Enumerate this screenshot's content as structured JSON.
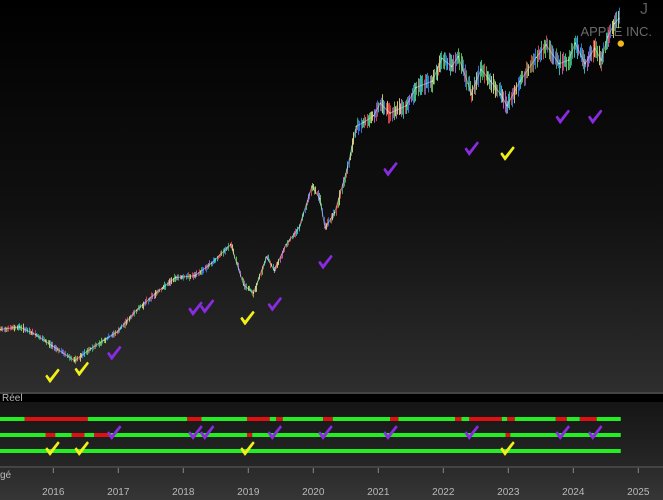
{
  "header": {
    "company_name": "APPLE INC.",
    "corner_symbol": "J"
  },
  "panels": {
    "mode_label": "Réel",
    "indicator_label": "gé"
  },
  "colors": {
    "background": "#000000",
    "axis_text": "#b9b9b9",
    "band_green": "#22ee22",
    "band_red": "#dd1111",
    "check_yellow": "#f2ef1a",
    "check_purple": "#8a2be2",
    "last_price_marker": "#f2b619"
  },
  "icons": {
    "signal_strong": "yellow-check-icon",
    "signal_normal": "purple-check-icon"
  },
  "chart_data": {
    "type": "line",
    "title": "APPLE INC.",
    "xlabel": "",
    "ylabel": "",
    "x_ticks": [
      "2016",
      "2017",
      "2018",
      "2019",
      "2020",
      "2021",
      "2022",
      "2023",
      "2024",
      "2025"
    ],
    "x_range": [
      2015.2,
      2025.4
    ],
    "y_scale": "log",
    "grid": false,
    "series": [
      {
        "x": [
          2015.2,
          2015.5,
          2015.75,
          2016.0,
          2016.35,
          2016.6,
          2016.8,
          2017.0,
          2017.3,
          2017.6,
          2017.9,
          2018.2,
          2018.45,
          2018.75,
          2018.95,
          2019.1,
          2019.3,
          2019.42,
          2019.6,
          2019.8,
          2020.0,
          2020.12,
          2020.2,
          2020.35,
          2020.55,
          2020.68,
          2020.8,
          2020.95,
          2021.05,
          2021.2,
          2021.45,
          2021.6,
          2021.85,
          2022.0,
          2022.15,
          2022.25,
          2022.4,
          2022.45,
          2022.6,
          2022.75,
          2022.9,
          2023.0,
          2023.2,
          2023.45,
          2023.6,
          2023.8,
          2023.95,
          2024.05,
          2024.2,
          2024.35,
          2024.45,
          2024.55,
          2024.65,
          2024.72
        ],
        "values": [
          30,
          30.5,
          29,
          27,
          24.5,
          26.5,
          28,
          29.5,
          34,
          38,
          42,
          42.5,
          46,
          52,
          40,
          38,
          48,
          44,
          52,
          58,
          76,
          70,
          58,
          64,
          86,
          112,
          115,
          120,
          130,
          122,
          128,
          144,
          150,
          174,
          165,
          176,
          148,
          138,
          162,
          150,
          138,
          128,
          150,
          175,
          190,
          168,
          172,
          192,
          168,
          186,
          172,
          200,
          218,
          225
        ]
      }
    ],
    "last_price": {
      "x": 2024.72,
      "y": 218
    },
    "signals": [
      {
        "x": 2016.0,
        "kind": "strong",
        "y": 22
      },
      {
        "x": 2016.45,
        "kind": "strong",
        "y": 23
      },
      {
        "x": 2016.95,
        "kind": "normal",
        "y": 25.5
      },
      {
        "x": 2018.2,
        "kind": "normal",
        "y": 34
      },
      {
        "x": 2018.38,
        "kind": "normal",
        "y": 34.5
      },
      {
        "x": 2019.0,
        "kind": "strong",
        "y": 32
      },
      {
        "x": 2019.42,
        "kind": "normal",
        "y": 35
      },
      {
        "x": 2020.2,
        "kind": "normal",
        "y": 46
      },
      {
        "x": 2021.2,
        "kind": "normal",
        "y": 84
      },
      {
        "x": 2022.45,
        "kind": "normal",
        "y": 96
      },
      {
        "x": 2023.0,
        "kind": "strong",
        "y": 93
      },
      {
        "x": 2023.85,
        "kind": "normal",
        "y": 118
      },
      {
        "x": 2024.35,
        "kind": "normal",
        "y": 118
      }
    ],
    "bands": [
      {
        "segments": [
          [
            2015.2,
            2015.58,
            "green"
          ],
          [
            2015.58,
            2016.55,
            "red"
          ],
          [
            2016.55,
            2018.08,
            "green"
          ],
          [
            2018.08,
            2018.3,
            "red"
          ],
          [
            2018.3,
            2019.0,
            "green"
          ],
          [
            2019.0,
            2019.35,
            "red"
          ],
          [
            2019.35,
            2019.45,
            "green"
          ],
          [
            2019.45,
            2019.55,
            "red"
          ],
          [
            2019.55,
            2020.17,
            "green"
          ],
          [
            2020.17,
            2020.32,
            "red"
          ],
          [
            2020.32,
            2021.2,
            "green"
          ],
          [
            2021.2,
            2021.33,
            "red"
          ],
          [
            2021.33,
            2022.2,
            "green"
          ],
          [
            2022.2,
            2022.3,
            "red"
          ],
          [
            2022.3,
            2022.42,
            "green"
          ],
          [
            2022.42,
            2022.92,
            "red"
          ],
          [
            2022.92,
            2023.0,
            "green"
          ],
          [
            2023.0,
            2023.12,
            "red"
          ],
          [
            2023.12,
            2023.75,
            "green"
          ],
          [
            2023.75,
            2023.92,
            "red"
          ],
          [
            2023.92,
            2024.12,
            "green"
          ],
          [
            2024.12,
            2024.38,
            "red"
          ],
          [
            2024.38,
            2024.75,
            "green"
          ]
        ]
      },
      {
        "segments": [
          [
            2015.2,
            2015.9,
            "green"
          ],
          [
            2015.9,
            2016.05,
            "red"
          ],
          [
            2016.05,
            2016.3,
            "green"
          ],
          [
            2016.3,
            2016.5,
            "red"
          ],
          [
            2016.5,
            2016.65,
            "green"
          ],
          [
            2016.65,
            2016.88,
            "red"
          ],
          [
            2016.88,
            2019.0,
            "green"
          ],
          [
            2019.0,
            2019.08,
            "red"
          ],
          [
            2019.08,
            2022.98,
            "green"
          ],
          [
            2022.98,
            2023.05,
            "red"
          ],
          [
            2023.05,
            2024.75,
            "green"
          ]
        ]
      },
      {
        "segments": [
          [
            2015.2,
            2024.75,
            "green"
          ]
        ]
      }
    ]
  }
}
